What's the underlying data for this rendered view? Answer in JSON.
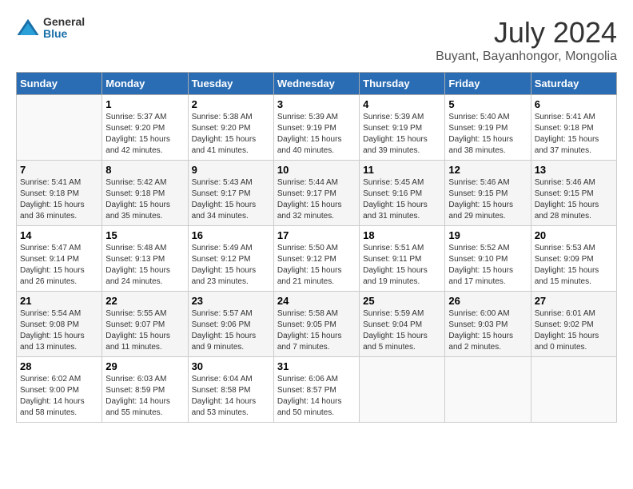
{
  "header": {
    "logo_general": "General",
    "logo_blue": "Blue",
    "month_title": "July 2024",
    "location": "Buyant, Bayanhongor, Mongolia"
  },
  "weekdays": [
    "Sunday",
    "Monday",
    "Tuesday",
    "Wednesday",
    "Thursday",
    "Friday",
    "Saturday"
  ],
  "weeks": [
    [
      {
        "day": "",
        "sunrise": "",
        "sunset": "",
        "daylight": ""
      },
      {
        "day": "1",
        "sunrise": "Sunrise: 5:37 AM",
        "sunset": "Sunset: 9:20 PM",
        "daylight": "Daylight: 15 hours and 42 minutes."
      },
      {
        "day": "2",
        "sunrise": "Sunrise: 5:38 AM",
        "sunset": "Sunset: 9:20 PM",
        "daylight": "Daylight: 15 hours and 41 minutes."
      },
      {
        "day": "3",
        "sunrise": "Sunrise: 5:39 AM",
        "sunset": "Sunset: 9:19 PM",
        "daylight": "Daylight: 15 hours and 40 minutes."
      },
      {
        "day": "4",
        "sunrise": "Sunrise: 5:39 AM",
        "sunset": "Sunset: 9:19 PM",
        "daylight": "Daylight: 15 hours and 39 minutes."
      },
      {
        "day": "5",
        "sunrise": "Sunrise: 5:40 AM",
        "sunset": "Sunset: 9:19 PM",
        "daylight": "Daylight: 15 hours and 38 minutes."
      },
      {
        "day": "6",
        "sunrise": "Sunrise: 5:41 AM",
        "sunset": "Sunset: 9:18 PM",
        "daylight": "Daylight: 15 hours and 37 minutes."
      }
    ],
    [
      {
        "day": "7",
        "sunrise": "Sunrise: 5:41 AM",
        "sunset": "Sunset: 9:18 PM",
        "daylight": "Daylight: 15 hours and 36 minutes."
      },
      {
        "day": "8",
        "sunrise": "Sunrise: 5:42 AM",
        "sunset": "Sunset: 9:18 PM",
        "daylight": "Daylight: 15 hours and 35 minutes."
      },
      {
        "day": "9",
        "sunrise": "Sunrise: 5:43 AM",
        "sunset": "Sunset: 9:17 PM",
        "daylight": "Daylight: 15 hours and 34 minutes."
      },
      {
        "day": "10",
        "sunrise": "Sunrise: 5:44 AM",
        "sunset": "Sunset: 9:17 PM",
        "daylight": "Daylight: 15 hours and 32 minutes."
      },
      {
        "day": "11",
        "sunrise": "Sunrise: 5:45 AM",
        "sunset": "Sunset: 9:16 PM",
        "daylight": "Daylight: 15 hours and 31 minutes."
      },
      {
        "day": "12",
        "sunrise": "Sunrise: 5:46 AM",
        "sunset": "Sunset: 9:15 PM",
        "daylight": "Daylight: 15 hours and 29 minutes."
      },
      {
        "day": "13",
        "sunrise": "Sunrise: 5:46 AM",
        "sunset": "Sunset: 9:15 PM",
        "daylight": "Daylight: 15 hours and 28 minutes."
      }
    ],
    [
      {
        "day": "14",
        "sunrise": "Sunrise: 5:47 AM",
        "sunset": "Sunset: 9:14 PM",
        "daylight": "Daylight: 15 hours and 26 minutes."
      },
      {
        "day": "15",
        "sunrise": "Sunrise: 5:48 AM",
        "sunset": "Sunset: 9:13 PM",
        "daylight": "Daylight: 15 hours and 24 minutes."
      },
      {
        "day": "16",
        "sunrise": "Sunrise: 5:49 AM",
        "sunset": "Sunset: 9:12 PM",
        "daylight": "Daylight: 15 hours and 23 minutes."
      },
      {
        "day": "17",
        "sunrise": "Sunrise: 5:50 AM",
        "sunset": "Sunset: 9:12 PM",
        "daylight": "Daylight: 15 hours and 21 minutes."
      },
      {
        "day": "18",
        "sunrise": "Sunrise: 5:51 AM",
        "sunset": "Sunset: 9:11 PM",
        "daylight": "Daylight: 15 hours and 19 minutes."
      },
      {
        "day": "19",
        "sunrise": "Sunrise: 5:52 AM",
        "sunset": "Sunset: 9:10 PM",
        "daylight": "Daylight: 15 hours and 17 minutes."
      },
      {
        "day": "20",
        "sunrise": "Sunrise: 5:53 AM",
        "sunset": "Sunset: 9:09 PM",
        "daylight": "Daylight: 15 hours and 15 minutes."
      }
    ],
    [
      {
        "day": "21",
        "sunrise": "Sunrise: 5:54 AM",
        "sunset": "Sunset: 9:08 PM",
        "daylight": "Daylight: 15 hours and 13 minutes."
      },
      {
        "day": "22",
        "sunrise": "Sunrise: 5:55 AM",
        "sunset": "Sunset: 9:07 PM",
        "daylight": "Daylight: 15 hours and 11 minutes."
      },
      {
        "day": "23",
        "sunrise": "Sunrise: 5:57 AM",
        "sunset": "Sunset: 9:06 PM",
        "daylight": "Daylight: 15 hours and 9 minutes."
      },
      {
        "day": "24",
        "sunrise": "Sunrise: 5:58 AM",
        "sunset": "Sunset: 9:05 PM",
        "daylight": "Daylight: 15 hours and 7 minutes."
      },
      {
        "day": "25",
        "sunrise": "Sunrise: 5:59 AM",
        "sunset": "Sunset: 9:04 PM",
        "daylight": "Daylight: 15 hours and 5 minutes."
      },
      {
        "day": "26",
        "sunrise": "Sunrise: 6:00 AM",
        "sunset": "Sunset: 9:03 PM",
        "daylight": "Daylight: 15 hours and 2 minutes."
      },
      {
        "day": "27",
        "sunrise": "Sunrise: 6:01 AM",
        "sunset": "Sunset: 9:02 PM",
        "daylight": "Daylight: 15 hours and 0 minutes."
      }
    ],
    [
      {
        "day": "28",
        "sunrise": "Sunrise: 6:02 AM",
        "sunset": "Sunset: 9:00 PM",
        "daylight": "Daylight: 14 hours and 58 minutes."
      },
      {
        "day": "29",
        "sunrise": "Sunrise: 6:03 AM",
        "sunset": "Sunset: 8:59 PM",
        "daylight": "Daylight: 14 hours and 55 minutes."
      },
      {
        "day": "30",
        "sunrise": "Sunrise: 6:04 AM",
        "sunset": "Sunset: 8:58 PM",
        "daylight": "Daylight: 14 hours and 53 minutes."
      },
      {
        "day": "31",
        "sunrise": "Sunrise: 6:06 AM",
        "sunset": "Sunset: 8:57 PM",
        "daylight": "Daylight: 14 hours and 50 minutes."
      },
      {
        "day": "",
        "sunrise": "",
        "sunset": "",
        "daylight": ""
      },
      {
        "day": "",
        "sunrise": "",
        "sunset": "",
        "daylight": ""
      },
      {
        "day": "",
        "sunrise": "",
        "sunset": "",
        "daylight": ""
      }
    ]
  ]
}
